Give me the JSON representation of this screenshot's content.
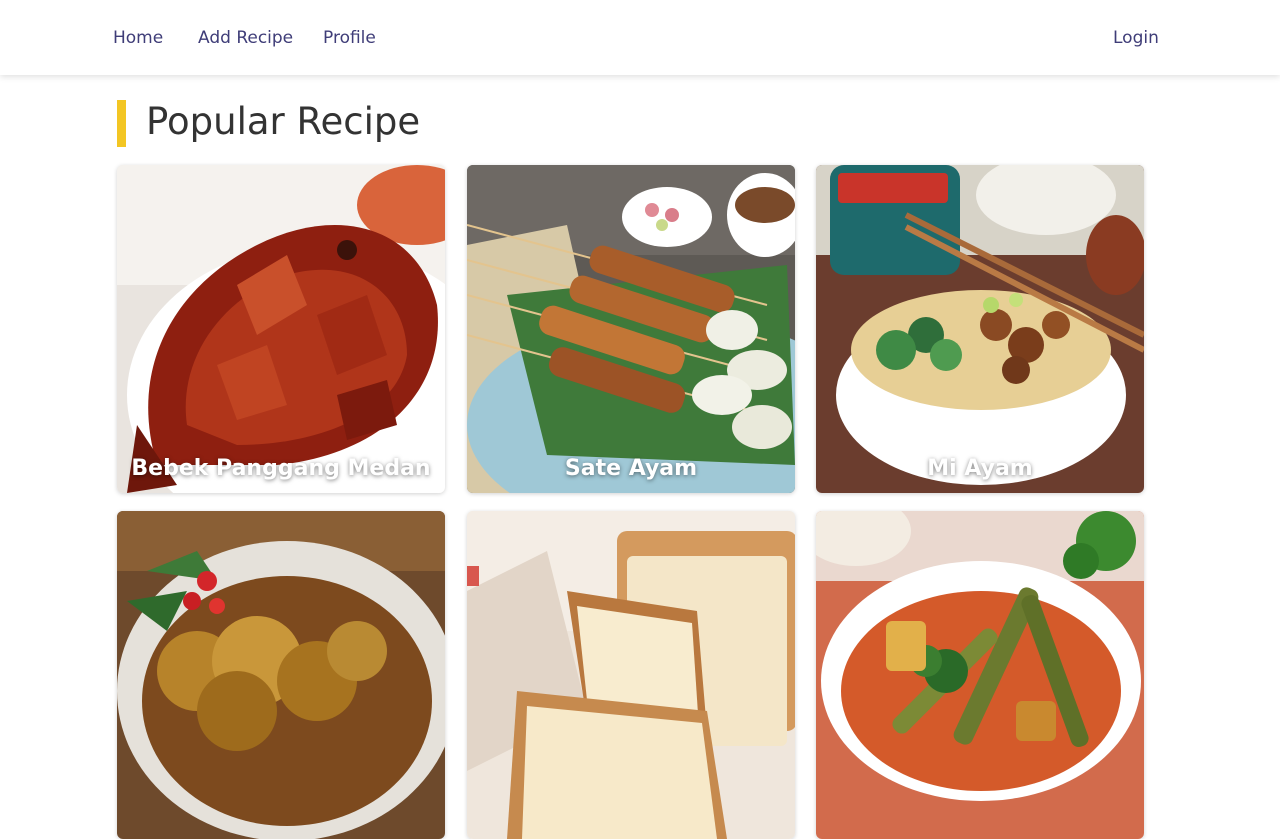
{
  "nav": {
    "home": "Home",
    "add_recipe": "Add Recipe",
    "profile": "Profile",
    "login": "Login"
  },
  "section": {
    "title": "Popular Recipe",
    "accent_color": "#f3c623"
  },
  "recipes": [
    {
      "title": "Bebek Panggang Medan"
    },
    {
      "title": "Sate Ayam"
    },
    {
      "title": "Mi Ayam"
    },
    {
      "title": ""
    },
    {
      "title": ""
    },
    {
      "title": ""
    }
  ]
}
